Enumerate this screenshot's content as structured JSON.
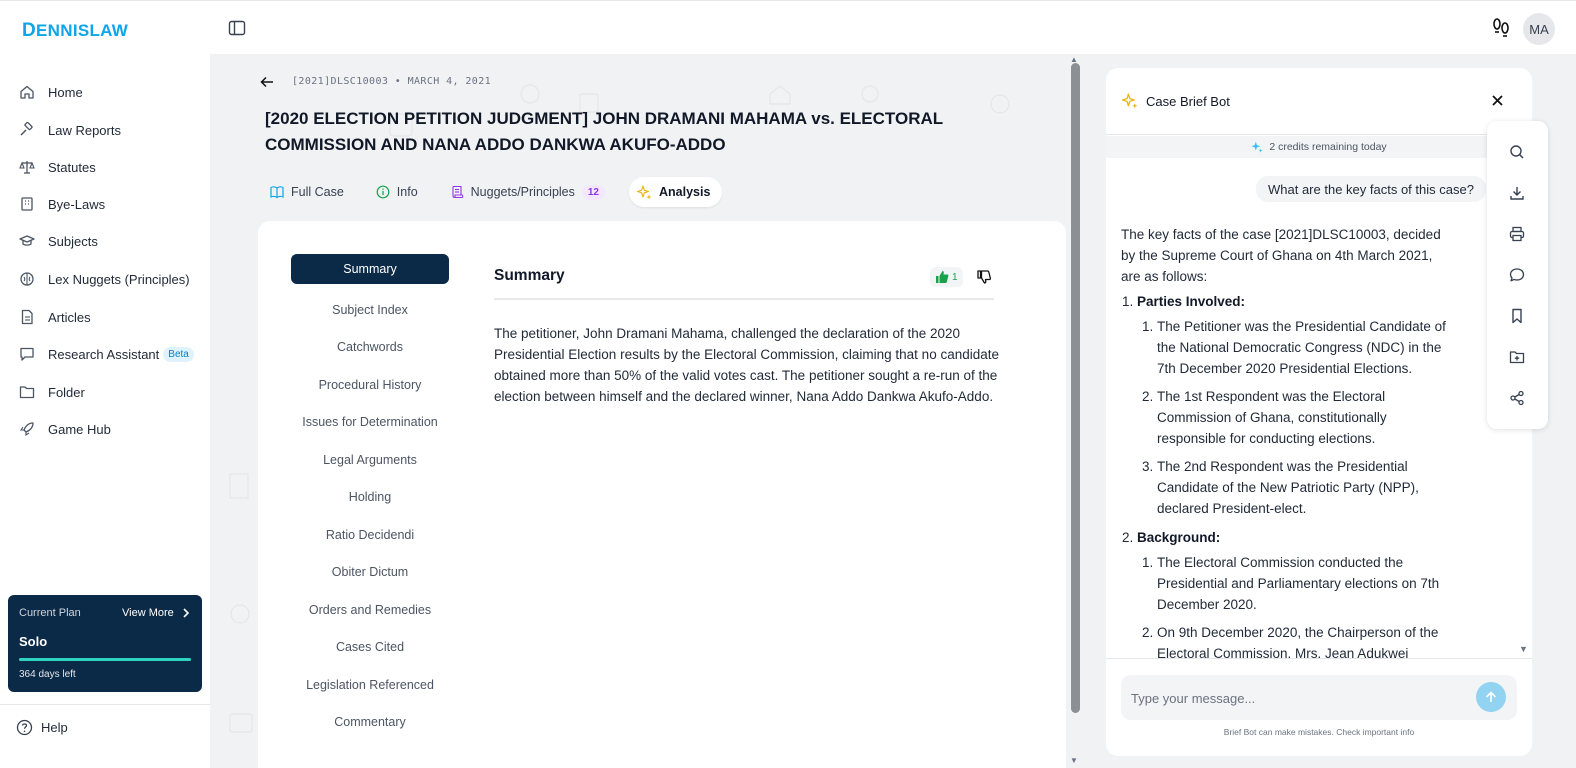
{
  "app": {
    "logo_initial": "D",
    "logo_rest": "ENNISLAW",
    "avatar_initials": "MA"
  },
  "sidebar": {
    "items": [
      {
        "label": "Home",
        "icon": "home-icon"
      },
      {
        "label": "Law Reports",
        "icon": "gavel-icon"
      },
      {
        "label": "Statutes",
        "icon": "scale-icon"
      },
      {
        "label": "Bye-Laws",
        "icon": "building-icon"
      },
      {
        "label": "Subjects",
        "icon": "graduation-cap-icon"
      },
      {
        "label": "Lex Nuggets (Principles)",
        "icon": "brain-icon"
      },
      {
        "label": "Articles",
        "icon": "document-icon"
      },
      {
        "label": "Research Assistant",
        "icon": "chat-icon",
        "badge": "Beta"
      },
      {
        "label": "Folder",
        "icon": "folder-icon"
      },
      {
        "label": "Game Hub",
        "icon": "rocket-icon"
      }
    ],
    "plan": {
      "label": "Current Plan",
      "view_more": "View More",
      "name": "Solo",
      "remaining": "364 days left",
      "progress": 1.0
    },
    "help": "Help"
  },
  "case": {
    "meta": "[2021]DLSC10003 • MARCH 4, 2021",
    "title": "[2020 ELECTION PETITION JUDGMENT] JOHN DRAMANI MAHAMA vs. ELECTORAL COMMISSION AND NANA ADDO DANKWA AKUFO-ADDO",
    "tabs": [
      {
        "label": "Full Case",
        "icon": "book-icon"
      },
      {
        "label": "Info",
        "icon": "info-icon"
      },
      {
        "label": "Nuggets/Principles",
        "icon": "scroll-icon",
        "count": "12"
      },
      {
        "label": "Analysis",
        "icon": "sparkle-icon",
        "active": true
      }
    ],
    "analysis_menu": [
      "Summary",
      "Subject Index",
      "Catchwords",
      "Procedural History",
      "Issues for Determination",
      "Legal Arguments",
      "Holding",
      "Ratio Decidendi",
      "Obiter Dictum",
      "Orders and Remedies",
      "Cases Cited",
      "Legislation Referenced",
      "Commentary"
    ],
    "summary": {
      "title": "Summary",
      "likes": "1",
      "text": "The petitioner, John Dramani Mahama, challenged the declaration of the 2020 Presidential Election results by the Electoral Commission, claiming that no candidate obtained more than 50% of the valid votes cast. The petitioner sought a re-run of the election between himself and the declared winner, Nana Addo Dankwa Akufo-Addo."
    }
  },
  "bot": {
    "title": "Case Brief Bot",
    "credits": "2 credits remaining today",
    "user_message": "What are the key facts of this case?",
    "reply_intro": "The key facts of the case [2021]DLSC10003, decided by the Supreme Court of Ghana on 4th March 2021, are as follows:",
    "sections": [
      {
        "heading": "Parties Involved:",
        "points": [
          "The Petitioner was the Presidential Candidate of the National Democratic Congress (NDC) in the 7th December 2020 Presidential Elections.",
          "The 1st Respondent was the Electoral Commission of Ghana, constitutionally responsible for conducting elections.",
          "The 2nd Respondent was the Presidential Candidate of the New Patriotic Party (NPP), declared President-elect."
        ]
      },
      {
        "heading": "Background:",
        "points": [
          "The Electoral Commission conducted the Presidential and Parliamentary elections on 7th December 2020.",
          "On 9th December 2020, the Chairperson of the Electoral Commission, Mrs. Jean Adukwei"
        ]
      }
    ],
    "input_placeholder": "Type your message...",
    "disclaimer": "Brief Bot can make mistakes. Check important info",
    "tools": [
      "search-icon",
      "download-icon",
      "print-icon",
      "comment-icon",
      "bookmark-icon",
      "folder-add-icon",
      "share-icon"
    ]
  }
}
